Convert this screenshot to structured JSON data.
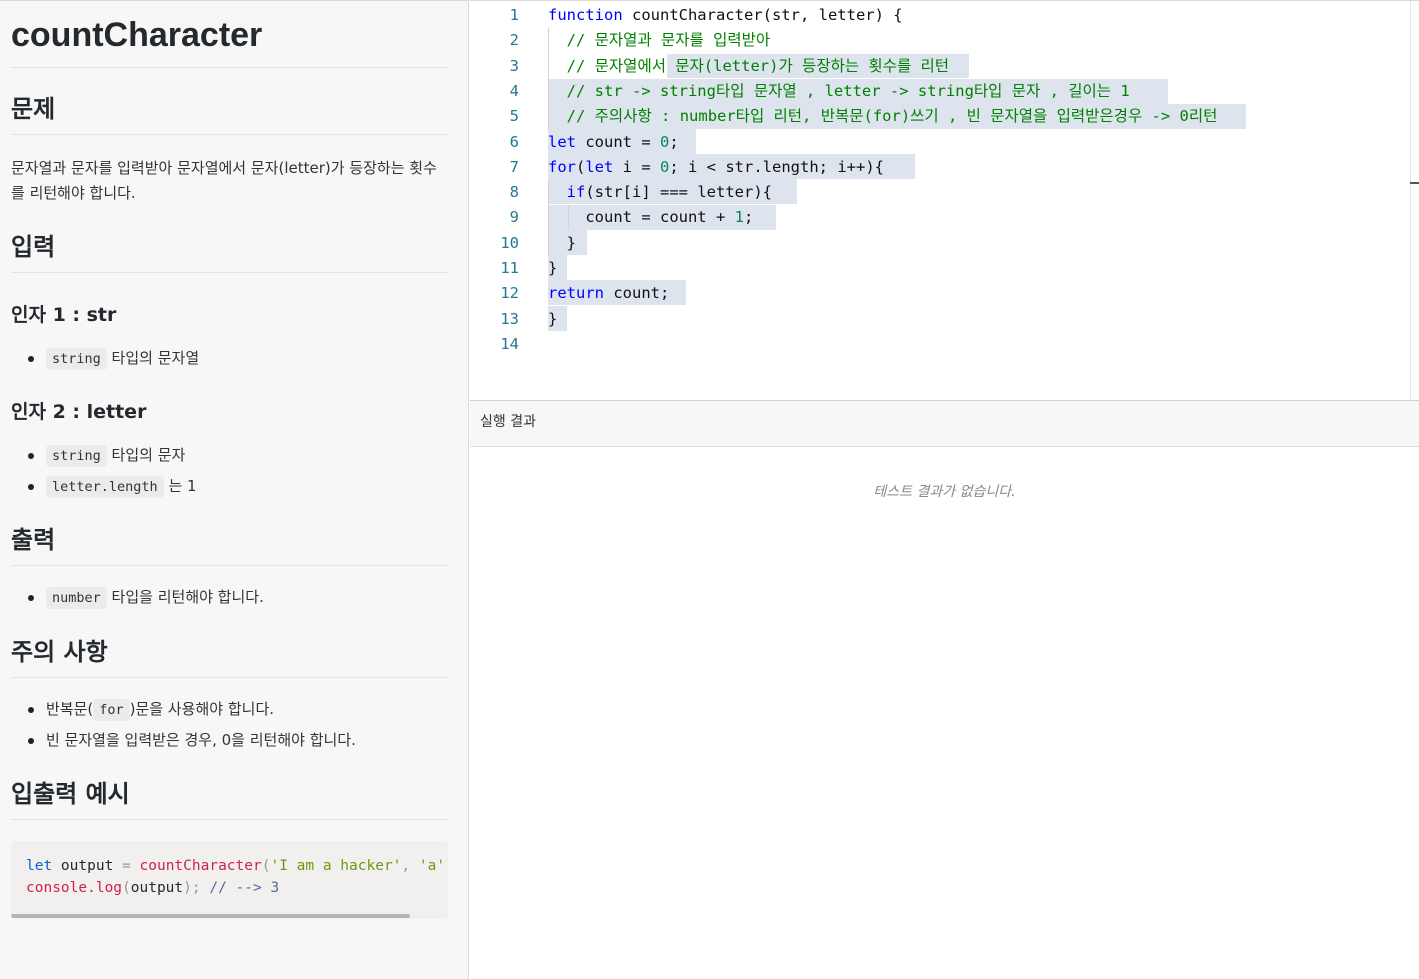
{
  "problem": {
    "title": "countCharacter",
    "section_problem": "문제",
    "description": "문자열과 문자를 입력받아 문자열에서 문자(letter)가 등장하는 횟수를 리턴해야 합니다.",
    "section_input": "입력",
    "arg1_title": "인자 1 : str",
    "arg1_items": [
      {
        "code": "string",
        "text": " 타입의 문자열"
      }
    ],
    "arg2_title": "인자 2 : letter",
    "arg2_items": [
      {
        "code": "string",
        "text": " 타입의 문자"
      },
      {
        "code": "letter.length",
        "text": " 는 1"
      }
    ],
    "section_output": "출력",
    "output_items": [
      {
        "code": "number",
        "text": " 타입을 리턴해야 합니다."
      }
    ],
    "section_notes": "주의 사항",
    "notes_items": [
      {
        "pre": "반복문(",
        "code": "for",
        "post": ")문을 사용해야 합니다."
      },
      {
        "text": "빈 문자열을 입력받은 경우, 0을 리턴해야 합니다."
      }
    ],
    "section_example": "입출력 예시",
    "example_line1": {
      "kw": "let",
      "var": " output ",
      "op": "=",
      "fn": " countCharacter",
      "p1": "(",
      "arg1": "'I am a hacker'",
      "comma": ", ",
      "arg2": "'a'",
      "end": ");"
    },
    "example_line2": {
      "fn": "console.log",
      "p1": "(",
      "var": "output",
      "end": "); ",
      "comment": "// --> 3"
    }
  },
  "editor": {
    "line_numbers": [
      "1",
      "2",
      "3",
      "4",
      "5",
      "6",
      "7",
      "8",
      "9",
      "10",
      "11",
      "12",
      "13",
      "14"
    ],
    "lines": [
      [
        {
          "t": "function",
          "c": "kw"
        },
        {
          "t": " countCharacter(str, letter) {",
          "c": ""
        }
      ],
      [
        {
          "t": "  // 문자열과 문자를 입력받아",
          "c": "cm"
        }
      ],
      [
        {
          "t": "  // 문자열에서 문자(letter)가 등장하는 횟수를 리턴",
          "c": "cm"
        }
      ],
      [
        {
          "t": "  // str -> string타입 문자열 , letter -> string타입 문자 , 길이는 1",
          "c": "cm"
        }
      ],
      [
        {
          "t": "  // 주의사항 : number타입 리턴, 반복문(for)쓰기 , 빈 문자열을 입력받은경우 -> 0리턴",
          "c": "cm"
        }
      ],
      [
        {
          "t": "let",
          "c": "kw"
        },
        {
          "t": " count = ",
          "c": ""
        },
        {
          "t": "0",
          "c": "num"
        },
        {
          "t": ";",
          "c": ""
        }
      ],
      [
        {
          "t": "for",
          "c": "kw"
        },
        {
          "t": "(",
          "c": ""
        },
        {
          "t": "let",
          "c": "kw"
        },
        {
          "t": " i = ",
          "c": ""
        },
        {
          "t": "0",
          "c": "num"
        },
        {
          "t": "; i < str.length; i++){",
          "c": ""
        }
      ],
      [
        {
          "t": "  ",
          "c": ""
        },
        {
          "t": "if",
          "c": "kw"
        },
        {
          "t": "(str[i] === letter){",
          "c": ""
        }
      ],
      [
        {
          "t": "    count = count + ",
          "c": ""
        },
        {
          "t": "1",
          "c": "num"
        },
        {
          "t": ";",
          "c": ""
        }
      ],
      [
        {
          "t": "  }",
          "c": ""
        }
      ],
      [
        {
          "t": "}",
          "c": ""
        }
      ],
      [
        {
          "t": "return",
          "c": "kw"
        },
        {
          "t": " count;",
          "c": ""
        }
      ],
      [
        {
          "t": "}",
          "c": ""
        }
      ],
      [
        {
          "t": "",
          "c": ""
        }
      ]
    ]
  },
  "results": {
    "header": "실행 결과",
    "empty_message": "테스트 결과가 없습니다."
  }
}
